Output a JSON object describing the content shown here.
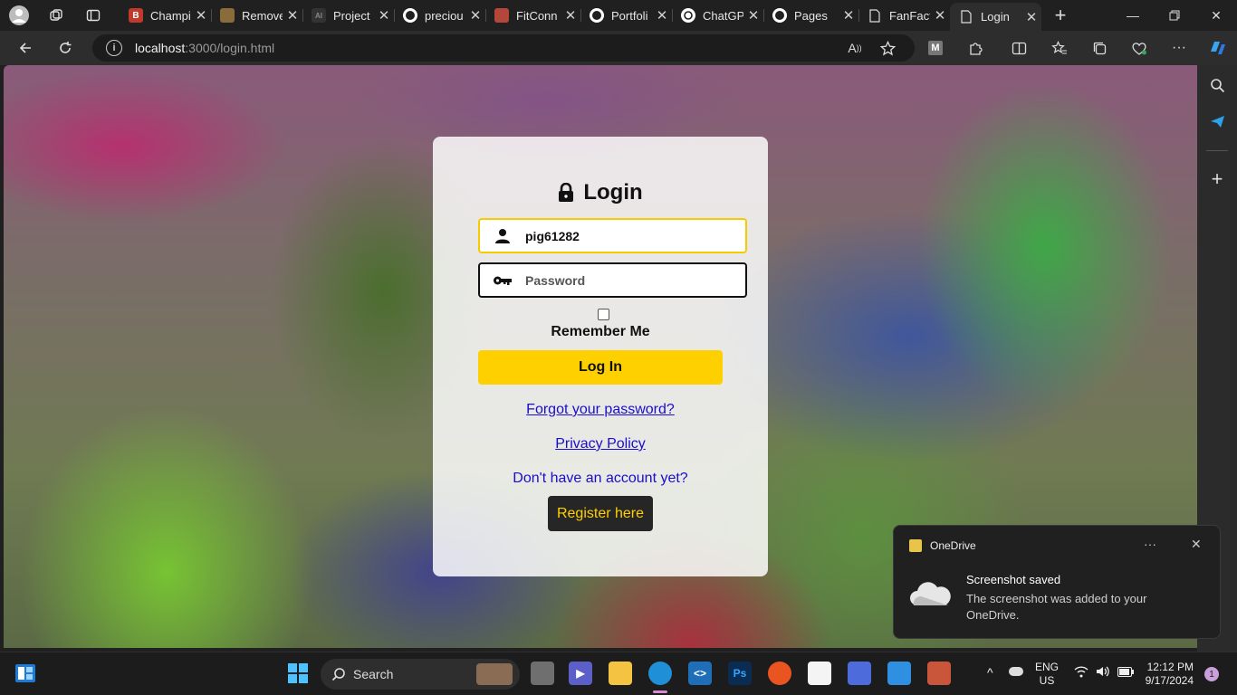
{
  "browser": {
    "tabs": [
      {
        "label": "Champi",
        "fav_color": "#c0392b",
        "fav_text": "B"
      },
      {
        "label": "Remove",
        "fav_color": "#8a6b3a",
        "fav_text": ""
      },
      {
        "label": "Project",
        "fav_color": "#333333",
        "fav_text": "AI"
      },
      {
        "label": "preciou",
        "fav_color": "#ffffff",
        "fav_text": ""
      },
      {
        "label": "FitConn",
        "fav_color": "#b5473a",
        "fav_text": ""
      },
      {
        "label": "Portfoli",
        "fav_color": "#ffffff",
        "fav_text": ""
      },
      {
        "label": "ChatGP",
        "fav_color": "#ffffff",
        "fav_text": ""
      },
      {
        "label": "Pages",
        "fav_color": "#ffffff",
        "fav_text": ""
      },
      {
        "label": "FanFact",
        "fav_color": "#ffffff",
        "fav_text": ""
      },
      {
        "label": "Login",
        "fav_color": "#ffffff",
        "fav_text": ""
      }
    ],
    "url_host": "localhost",
    "url_rest": ":3000/login.html"
  },
  "login": {
    "title": "Login",
    "username_value": "pig61282",
    "password_placeholder": "Password",
    "remember_label": "Remember Me",
    "login_button": "Log In",
    "forgot_link": "Forgot your password?",
    "privacy_link": "Privacy Policy",
    "no_account_text": "Don't have an account yet?",
    "register_button": "Register here"
  },
  "toast": {
    "app": "OneDrive",
    "heading": "Screenshot saved",
    "body": "The screenshot was added to your OneDrive.",
    "more": "···",
    "close": "✕"
  },
  "taskbar": {
    "search_label": "Search",
    "lang": "ENG",
    "region": "US",
    "time": "12:12 PM",
    "date": "9/17/2024",
    "notification_count": "1"
  },
  "colors": {
    "accent": "#ffd000",
    "link": "#1a0dcc",
    "focus_border": "#f6cb00"
  }
}
